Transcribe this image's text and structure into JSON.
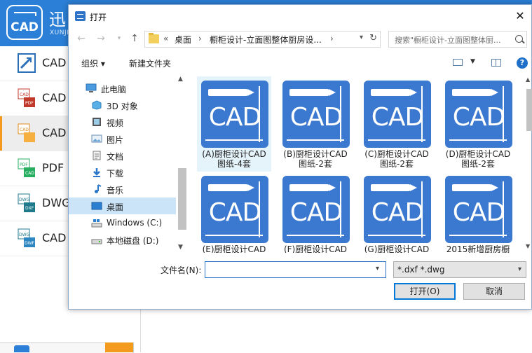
{
  "app": {
    "logo_text": "CAD",
    "name": "迅",
    "sub": "XUNJI",
    "sidebar": [
      {
        "label": "CAD",
        "icon": "pdf-to-cad-icon"
      },
      {
        "label": "CAD",
        "icon": "cad-to-pdf-icon"
      },
      {
        "label": "CAD",
        "icon": "cad-to-image-icon"
      },
      {
        "label": "PDF",
        "icon": "pdf-to-cad-icon"
      },
      {
        "label": "DWG",
        "icon": "dwg-to-dxf-icon"
      },
      {
        "label": "CAD",
        "icon": "dwg-to-dwf-icon"
      }
    ]
  },
  "dialog": {
    "title": "打开",
    "close": "✕",
    "address": {
      "prefix": "«",
      "crumbs": [
        "桌面",
        "橱柜设计-立面图整体厨房设..."
      ],
      "sep": "›"
    },
    "search_placeholder": "搜索\"橱柜设计-立面图整体厨...",
    "toolbar": {
      "organize": "组织 ▾",
      "new_folder": "新建文件夹",
      "help": "?"
    },
    "tree": [
      {
        "label": "此电脑",
        "icon": "computer-icon"
      },
      {
        "label": "3D 对象",
        "icon": "3d-objects-icon"
      },
      {
        "label": "视频",
        "icon": "video-icon"
      },
      {
        "label": "图片",
        "icon": "pictures-icon"
      },
      {
        "label": "文档",
        "icon": "documents-icon"
      },
      {
        "label": "下载",
        "icon": "download-icon"
      },
      {
        "label": "音乐",
        "icon": "music-icon"
      },
      {
        "label": "桌面",
        "icon": "desktop-icon",
        "selected": true
      },
      {
        "label": "Windows (C:)",
        "icon": "windows-drive-icon"
      },
      {
        "label": "本地磁盘 (D:)",
        "icon": "local-disk-icon"
      }
    ],
    "files": [
      {
        "line1": "(A)厨柜设计CAD",
        "line2": "图纸-4套"
      },
      {
        "line1": "(B)厨柜设计CAD",
        "line2": "图纸-2套"
      },
      {
        "line1": "(C)厨柜设计CAD",
        "line2": "图纸-2套"
      },
      {
        "line1": "(D)厨柜设计CAD",
        "line2": "图纸-2套"
      },
      {
        "line1": "(E)厨柜设计CAD",
        "line2": ""
      },
      {
        "line1": "(F)厨柜设计CAD",
        "line2": ""
      },
      {
        "line1": "(G)厨柜设计CAD",
        "line2": ""
      },
      {
        "line1": "2015新增厨房橱",
        "line2": ""
      }
    ],
    "thumb_text": "CAD",
    "filename_label": "文件名(N):",
    "filename_value": "",
    "filetype": "*.dxf *.dwg",
    "open_button": "打开(O)",
    "cancel_button": "取消"
  },
  "colors": {
    "accent": "#2b7fd6",
    "cad_blue": "#3b78d0",
    "selected": "#cce4f7",
    "orange": "#f39a1e"
  }
}
